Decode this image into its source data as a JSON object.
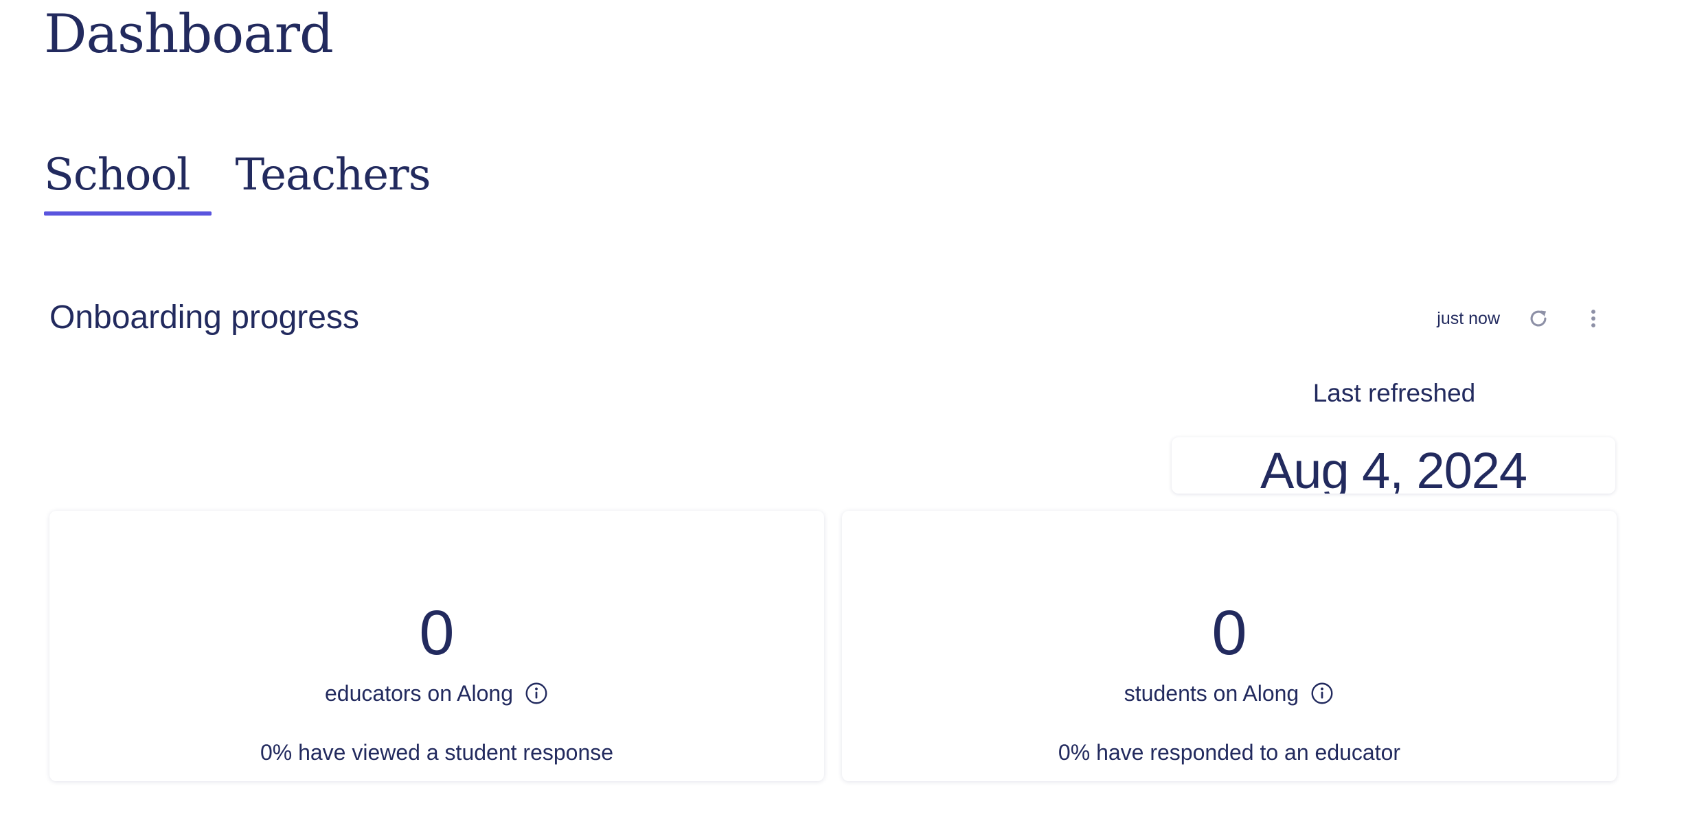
{
  "page": {
    "title": "Dashboard"
  },
  "tabs": [
    {
      "label": "School",
      "active": true
    },
    {
      "label": "Teachers",
      "active": false
    }
  ],
  "section": {
    "title": "Onboarding progress",
    "refresh_time": "just now",
    "icons": {
      "refresh": "refresh-icon",
      "menu": "more-vertical-icon"
    }
  },
  "last_refreshed": {
    "label": "Last refreshed",
    "date": "Aug 4, 2024"
  },
  "cards": [
    {
      "value": "0",
      "label": "educators on Along",
      "note": "0% have viewed a student response"
    },
    {
      "value": "0",
      "label": "students on Along",
      "note": "0% have responded to an educator"
    }
  ],
  "colors": {
    "text": "#222a5e",
    "accent": "#5a55de",
    "icon_gray": "#8d90a6"
  }
}
